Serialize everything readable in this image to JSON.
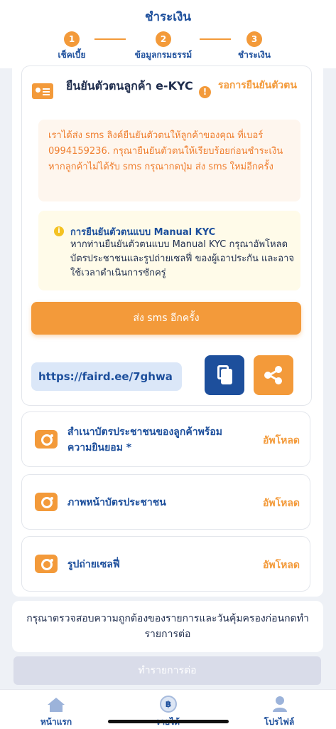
{
  "header": {
    "title": "ชำระเงิน",
    "steps": [
      {
        "number": "1",
        "label": "เช็คเบี้ย"
      },
      {
        "number": "2",
        "label": "ข้อมูลกรมธรรม์"
      },
      {
        "number": "3",
        "label": "ชำระเงิน"
      }
    ]
  },
  "kyc": {
    "title": "ยืนยันตัวตนลูกค้า e-KYC",
    "status": "รอการยืนยันตัวตน",
    "sms_note": "เราได้ส่ง sms ลิงค์ยืนยันตัวตนให้ลูกค้าของคุณ ที่เบอร์ 0994159236. กรุณายืนยันตัวตนให้เรียบร้อยก่อนชำระเงิน หากลูกค้าไม่ได้รับ sms กรุณากดปุ่ม ส่ง sms ใหม่อีกครั้ง",
    "manual_title": "การยืนยันตัวตนแบบ Manual KYC",
    "manual_desc": "หากท่านยืนยันตัวตนแบบ Manual KYC กรุณาอัพโหลดบัตรประชาชนและรูปถ่ายเซลฟี่ ของผู้เอาประกัน และอาจใช้เวลาดำเนินการซักครู่",
    "resend_label": "ส่ง sms อีกครั้ง",
    "link": "https://faird.ee/7ghwa"
  },
  "uploads": [
    {
      "label": "สำเนาบัตรประชาชนของลูกค้าพร้อมความยินยอม *",
      "action": "อัพโหลด"
    },
    {
      "label": "ภาพหน้าบัตรประชาชน",
      "action": "อัพโหลด"
    },
    {
      "label": "รูปถ่ายเซลฟี่",
      "action": "อัพโหลด"
    }
  ],
  "notice": "กรุณาตรวจสอบความถูกต้องของรายการและวันคุ้มครองก่อนกดทำรายการต่อ",
  "proceed_label": "ทำรายการต่อ",
  "nav": [
    {
      "label": "หน้าแรก",
      "icon": "home-icon"
    },
    {
      "label": "รายได้",
      "icon": "coin-icon"
    },
    {
      "label": "โปรไฟล์",
      "icon": "profile-icon"
    }
  ],
  "colors": {
    "primary": "#1d4f9c",
    "accent": "#f39a3a",
    "disabled": "#d9dce9"
  }
}
